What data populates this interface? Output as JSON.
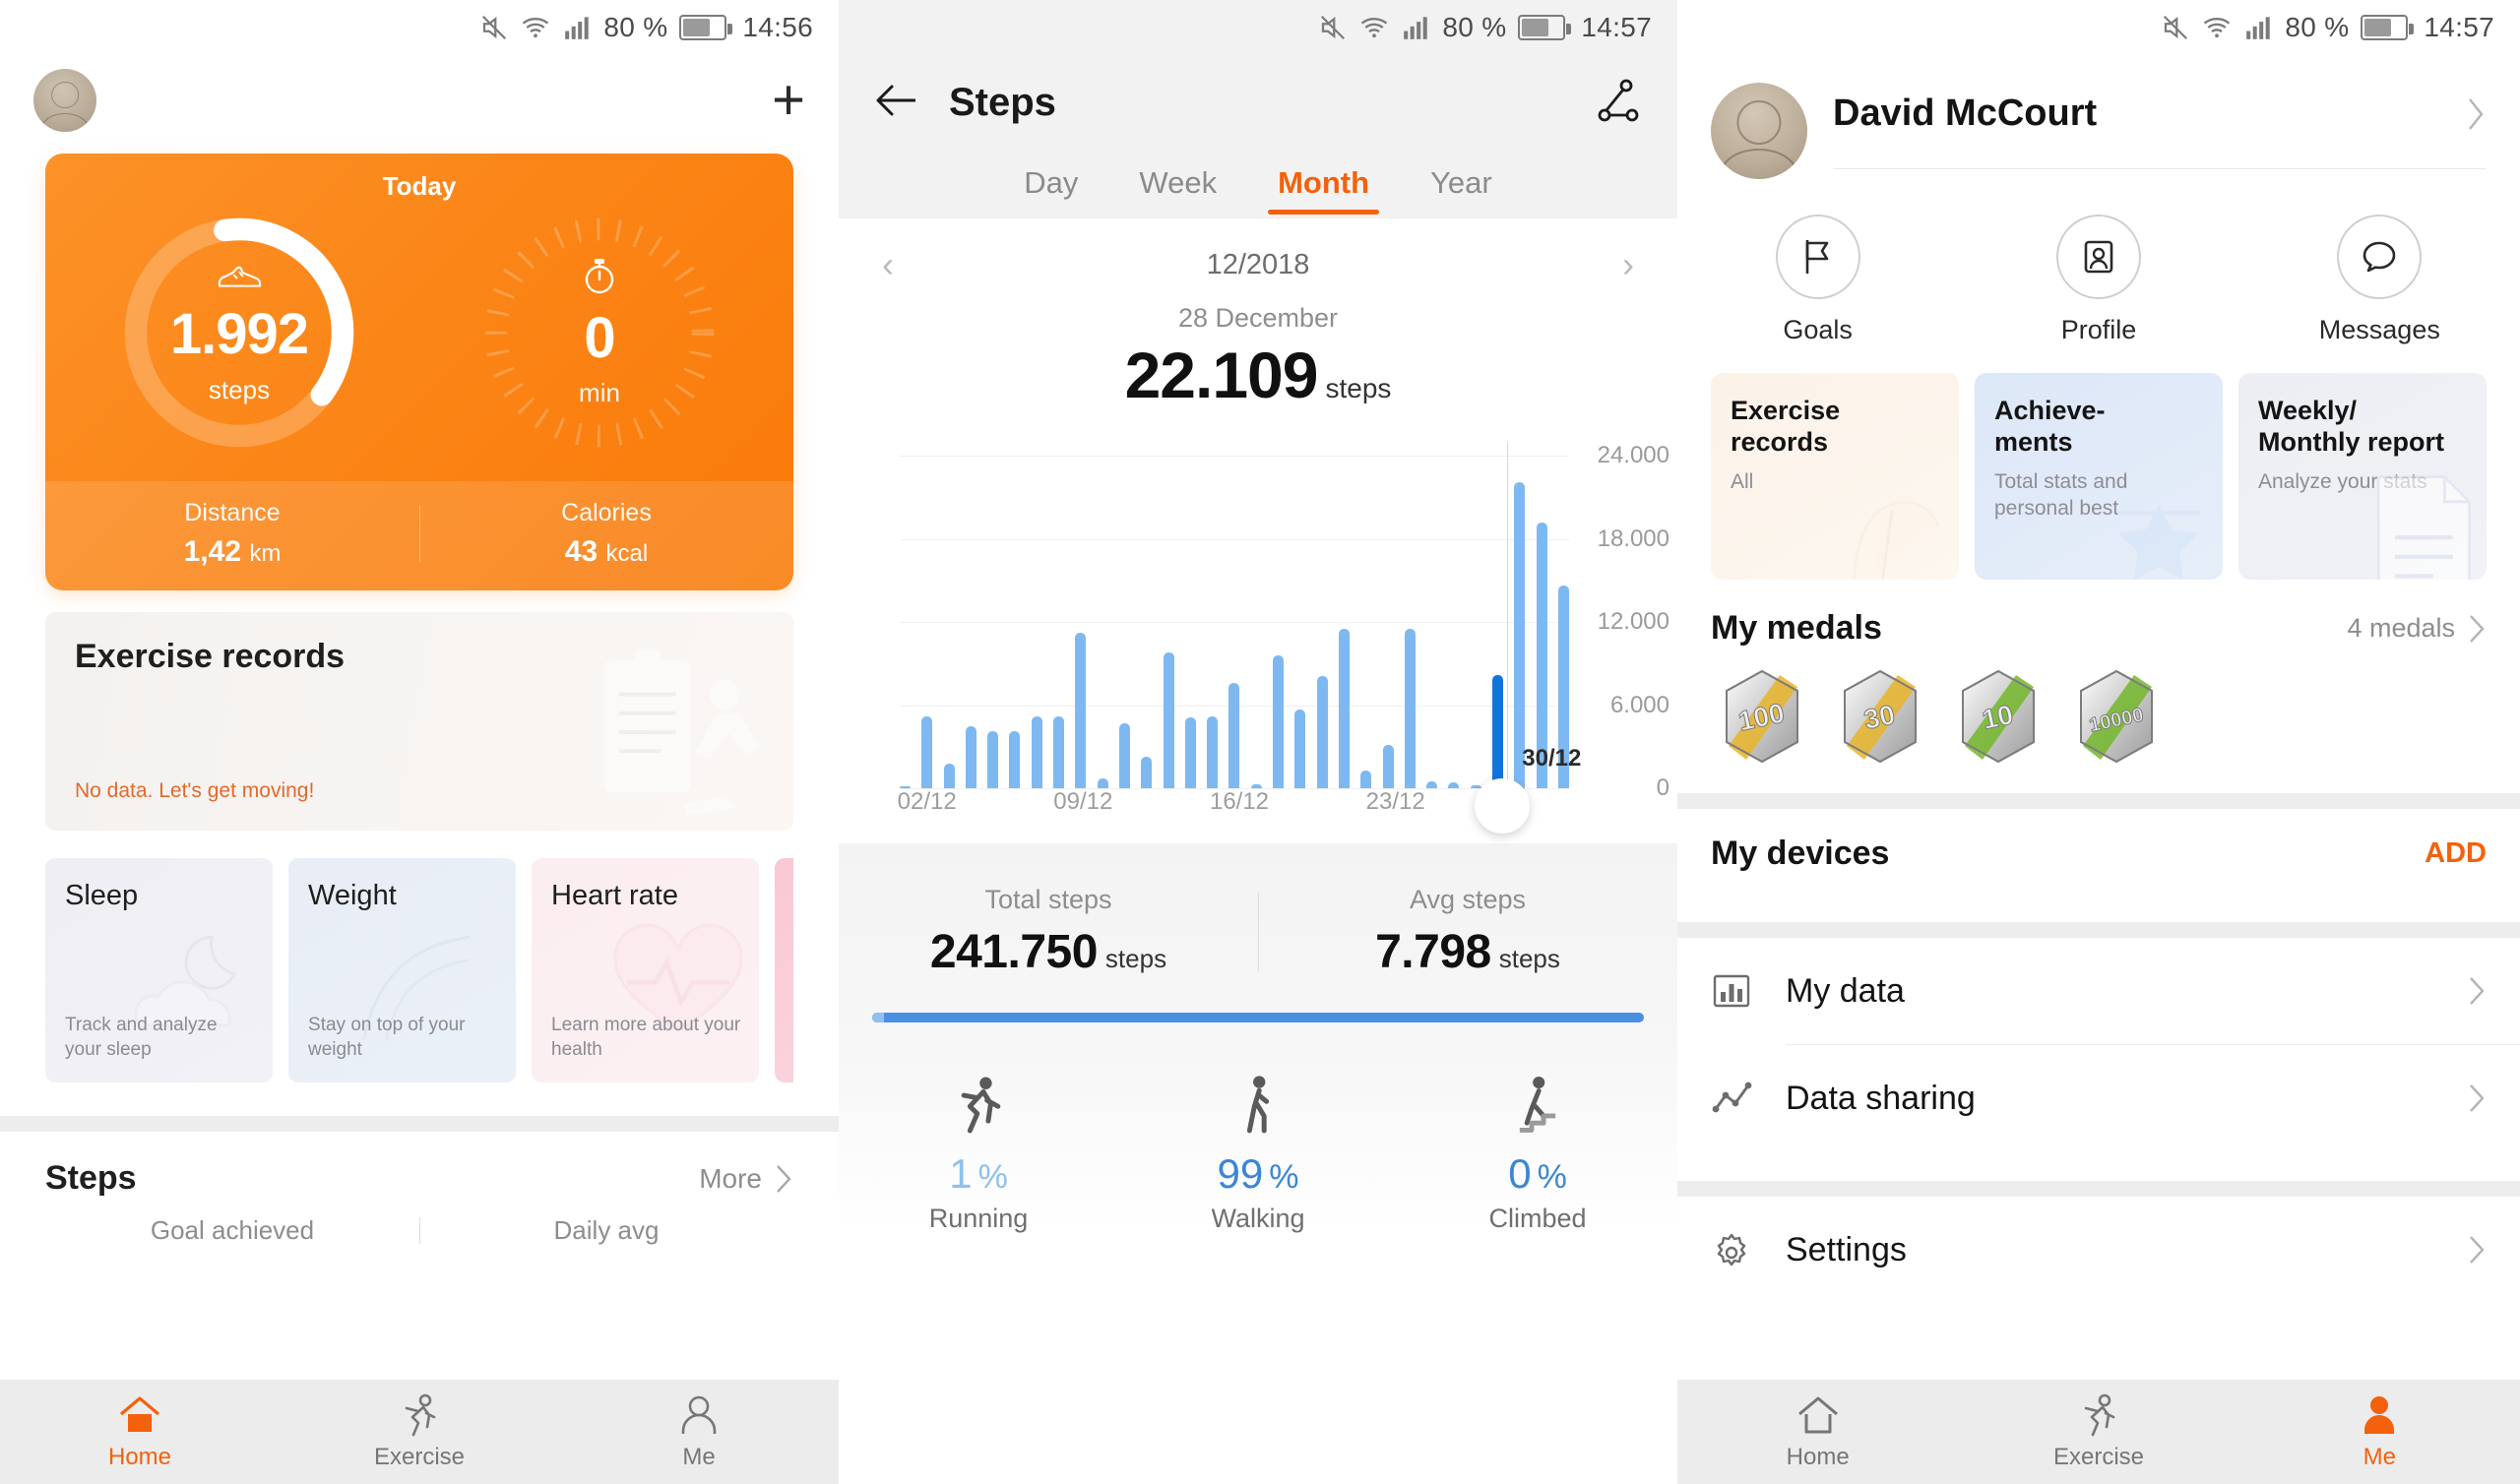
{
  "screens": {
    "home": {
      "statusbar": {
        "battery_pct": "80 %",
        "time": "14:56"
      },
      "header": {
        "avatar_name": "user-avatar",
        "add_label": "+"
      },
      "today_card": {
        "title": "Today",
        "steps_value": "1.992",
        "steps_unit": "steps",
        "duration_value": "0",
        "duration_unit": "min",
        "distance_label": "Distance",
        "distance_value": "1,42",
        "distance_unit": "km",
        "calories_label": "Calories",
        "calories_value": "43",
        "calories_unit": "kcal"
      },
      "exercise_records": {
        "title": "Exercise records",
        "empty_text": "No data. Let's get moving!"
      },
      "mini_cards": [
        {
          "title": "Sleep",
          "subtitle": "Track and analyze your sleep"
        },
        {
          "title": "Weight",
          "subtitle": "Stay on top of your weight"
        },
        {
          "title": "Heart rate",
          "subtitle": "Learn more about your health"
        }
      ],
      "steps_section": {
        "title": "Steps",
        "more_label": "More",
        "goal_label": "Goal achieved",
        "daily_avg_label": "Daily avg"
      },
      "bottom_nav": [
        {
          "label": "Home",
          "icon": "home-icon",
          "active": true
        },
        {
          "label": "Exercise",
          "icon": "runner-icon",
          "active": false
        },
        {
          "label": "Me",
          "icon": "person-icon",
          "active": false
        }
      ]
    },
    "steps": {
      "statusbar": {
        "battery_pct": "80 %",
        "time": "14:57"
      },
      "title": "Steps",
      "tabs": [
        {
          "label": "Day",
          "active": false
        },
        {
          "label": "Week",
          "active": false
        },
        {
          "label": "Month",
          "active": true
        },
        {
          "label": "Year",
          "active": false
        }
      ],
      "month_label": "12/2018",
      "selected_date": "28 December",
      "selected_value": "22.109",
      "selected_unit": "steps",
      "totals": {
        "total_label": "Total steps",
        "total_value": "241.750",
        "total_unit": "steps",
        "avg_label": "Avg steps",
        "avg_value": "7.798",
        "avg_unit": "steps"
      },
      "percentages": [
        {
          "label": "Running",
          "value": "1",
          "unit": "%",
          "icon": "running-icon",
          "color": "#8fc0ee"
        },
        {
          "label": "Walking",
          "value": "99",
          "unit": "%",
          "icon": "walking-icon",
          "color": "#3a86d6"
        },
        {
          "label": "Climbed",
          "value": "0",
          "unit": "%",
          "icon": "stairs-icon",
          "color": "#3a86d6"
        }
      ]
    },
    "me": {
      "statusbar": {
        "battery_pct": "80 %",
        "time": "14:57"
      },
      "profile_name": "David McCourt",
      "quick_actions": [
        {
          "label": "Goals",
          "icon": "flag-icon"
        },
        {
          "label": "Profile",
          "icon": "id-card-icon"
        },
        {
          "label": "Messages",
          "icon": "chat-bubble-icon"
        }
      ],
      "feature_cards": [
        {
          "title": "Exercise records",
          "subtitle": "All",
          "icon": "shoe-art"
        },
        {
          "title": "Achieve-\nments",
          "subtitle": "Total stats and personal best",
          "icon": "medal-art"
        },
        {
          "title": "Weekly/\nMonthly report",
          "subtitle": "Analyze your stats",
          "icon": "document-art"
        }
      ],
      "medals": {
        "title": "My medals",
        "count_label": "4 medals",
        "items": [
          {
            "label": "100",
            "accent": "#e8b52a"
          },
          {
            "label": "30",
            "accent": "#e8b52a"
          },
          {
            "label": "10",
            "accent": "#74b72b"
          },
          {
            "label": "10000",
            "accent": "#74b72b"
          }
        ]
      },
      "devices": {
        "title": "My devices",
        "add_label": "ADD"
      },
      "menu_items": [
        {
          "label": "My data",
          "icon": "bar-chart-icon"
        },
        {
          "label": "Data sharing",
          "icon": "line-chart-icon"
        },
        {
          "label": "Settings",
          "icon": "gear-icon"
        }
      ],
      "bottom_nav": [
        {
          "label": "Home",
          "icon": "home-icon",
          "active": false
        },
        {
          "label": "Exercise",
          "icon": "runner-icon",
          "active": false
        },
        {
          "label": "Me",
          "icon": "person-icon",
          "active": true
        }
      ]
    }
  },
  "colors": {
    "accent_orange": "#f4610c",
    "card_orange": "#fb8416",
    "bar_blue": "#7db9f0",
    "bar_selected_blue": "#1274dd",
    "text_dark": "#141414",
    "text_muted": "#8d8d8d"
  },
  "chart_data": {
    "type": "bar",
    "title": "Steps per day",
    "subtitle": "12/2018",
    "xlabel": "",
    "ylabel": "steps",
    "ylim": [
      0,
      24000
    ],
    "yticks": [
      0,
      6000,
      12000,
      18000,
      24000
    ],
    "ytick_labels": [
      "0",
      "6.000",
      "12.000",
      "18.000",
      "24.000"
    ],
    "grid": true,
    "legend": "none",
    "selected_index": 27,
    "selected_label": "28 December",
    "selected_value": 22109,
    "xtick_labels": [
      "02/12",
      "09/12",
      "16/12",
      "23/12",
      "30/12"
    ],
    "xtick_indices": [
      1,
      8,
      15,
      22,
      29
    ],
    "categories": [
      "01/12",
      "02/12",
      "03/12",
      "04/12",
      "05/12",
      "06/12",
      "07/12",
      "08/12",
      "09/12",
      "10/12",
      "11/12",
      "12/12",
      "13/12",
      "14/12",
      "15/12",
      "16/12",
      "17/12",
      "18/12",
      "19/12",
      "20/12",
      "21/12",
      "22/12",
      "23/12",
      "24/12",
      "25/12",
      "26/12",
      "27/12",
      "28/12",
      "29/12",
      "30/12",
      "31/12"
    ],
    "values": [
      0,
      5200,
      1800,
      4500,
      4100,
      4100,
      5200,
      5200,
      11200,
      700,
      4700,
      2300,
      9800,
      5100,
      5200,
      7600,
      300,
      9600,
      5700,
      8100,
      11500,
      1300,
      3100,
      11500,
      500,
      400,
      200,
      8200,
      22109,
      19200,
      14600
    ],
    "total": 241750,
    "average": 7798
  }
}
